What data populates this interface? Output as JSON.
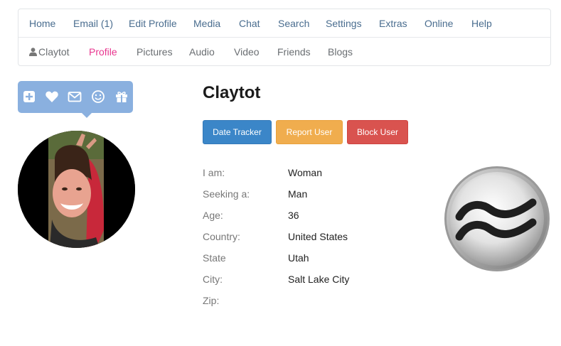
{
  "nav": {
    "top": [
      {
        "label": "Home"
      },
      {
        "label": "Email (1)"
      },
      {
        "label": "Edit Profile"
      },
      {
        "label": "Media"
      },
      {
        "label": "Chat"
      },
      {
        "label": "Search"
      },
      {
        "label": "Settings"
      },
      {
        "label": "Extras"
      },
      {
        "label": "Online"
      },
      {
        "label": "Help"
      }
    ],
    "sub": [
      {
        "label": "Claytot",
        "icon": "user-icon"
      },
      {
        "label": "Profile",
        "active": true
      },
      {
        "label": "Pictures"
      },
      {
        "label": "Audio"
      },
      {
        "label": "Video"
      },
      {
        "label": "Friends"
      },
      {
        "label": "Blogs"
      }
    ]
  },
  "actions": [
    {
      "icon": "add-icon"
    },
    {
      "icon": "heart-icon"
    },
    {
      "icon": "envelope-icon"
    },
    {
      "icon": "smiley-icon"
    },
    {
      "icon": "gift-icon"
    }
  ],
  "profile": {
    "name": "Claytot",
    "buttons": {
      "date_tracker": "Date Tracker",
      "report_user": "Report User",
      "block_user": "Block User"
    },
    "details": [
      {
        "label": "I am:",
        "value": "Woman"
      },
      {
        "label": "Seeking a:",
        "value": "Man"
      },
      {
        "label": "Age:",
        "value": "36"
      },
      {
        "label": "Country:",
        "value": "United States"
      },
      {
        "label": "State",
        "value": "Utah"
      },
      {
        "label": "City:",
        "value": "Salt Lake City"
      },
      {
        "label": "Zip:",
        "value": ""
      }
    ],
    "zodiac_icon": "aquarius-icon"
  },
  "colors": {
    "link": "#4a6d8f",
    "active": "#e8368f",
    "action_bar": "#8ab0df",
    "btn_blue": "#3b86c8",
    "btn_orange": "#f0ad4e",
    "btn_red": "#d9534f"
  }
}
